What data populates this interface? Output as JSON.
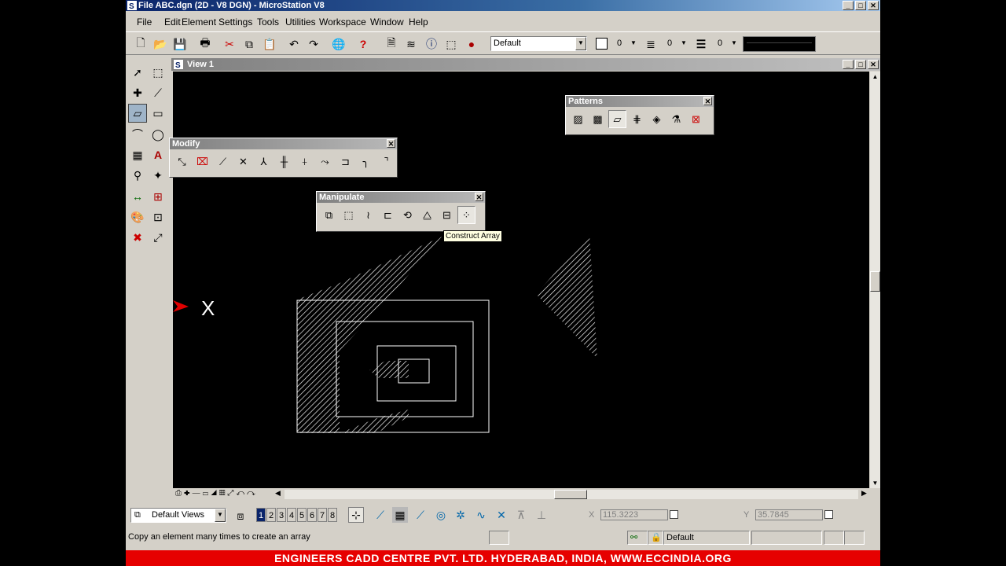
{
  "window": {
    "title": "File ABC.dgn (2D - V8 DGN) - MicroStation V8",
    "min": "_",
    "max": "□",
    "close": "✕"
  },
  "menu": [
    "File",
    "Edit",
    "Element",
    "Settings",
    "Tools",
    "Utilities",
    "Workspace",
    "Window",
    "Help"
  ],
  "toolbar": {
    "level": "Default",
    "color_value": "0",
    "style_value": "0",
    "weight_value": "0",
    "icons": [
      "new-file-icon",
      "open-folder-icon",
      "save-icon",
      "print-icon",
      "cut-icon",
      "copy-icon",
      "paste-icon",
      "undo-icon",
      "redo-icon",
      "globe-icon",
      "help-icon",
      "reference-icon",
      "levels-icon",
      "info-icon",
      "fence-icon",
      "render-icon"
    ]
  },
  "view": {
    "title": "View 1",
    "x_marker": "X"
  },
  "palettes": {
    "modify": {
      "title": "Modify",
      "close": "✕"
    },
    "manipulate": {
      "title": "Manipulate",
      "close": "✕"
    },
    "patterns": {
      "title": "Patterns",
      "close": "✕"
    }
  },
  "tooltip": "Construct Array",
  "bottom": {
    "views_combo": "Default Views",
    "view_numbers": [
      "1",
      "2",
      "3",
      "4",
      "5",
      "6",
      "7",
      "8"
    ],
    "x_label": "X",
    "x_value": "115.3223",
    "y_label": "Y",
    "y_value": "35.7845"
  },
  "status": {
    "prompt": "Copy an element many times to create an array",
    "level": "Default"
  },
  "banner": "ENGINEERS CADD CENTRE PVT. LTD. HYDERABAD, INDIA, WWW.ECCINDIA.ORG"
}
